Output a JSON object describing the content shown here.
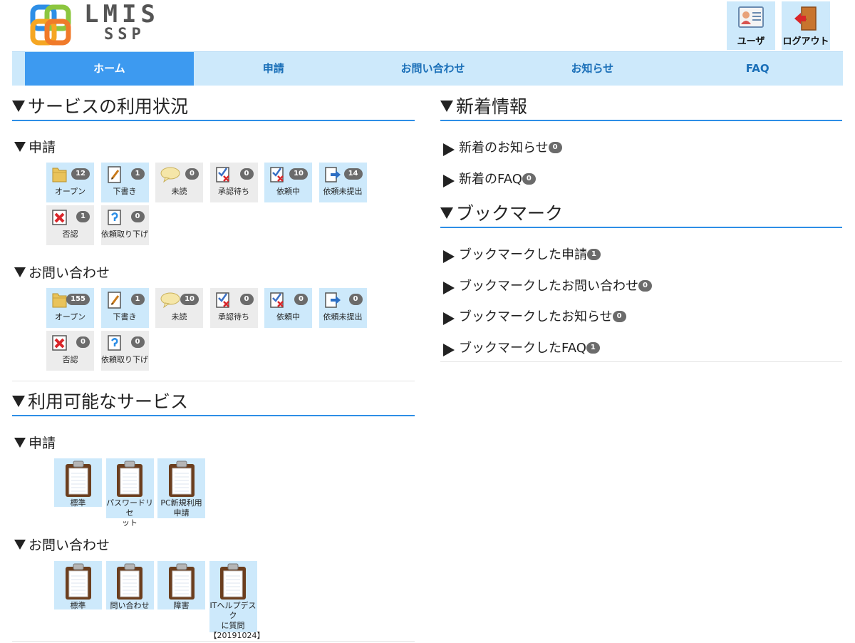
{
  "header": {
    "logo_line1": "LMIS",
    "logo_line2": "SSP",
    "user_label": "ユーザ",
    "logout_label": "ログアウト"
  },
  "nav": {
    "tabs": [
      {
        "label": "ホーム"
      },
      {
        "label": "申請"
      },
      {
        "label": "お問い合わせ"
      },
      {
        "label": "お知らせ"
      },
      {
        "label": "FAQ"
      }
    ]
  },
  "usage": {
    "title": "サービスの利用状況",
    "request": {
      "title": "申請",
      "tiles": [
        {
          "label": "オープン",
          "count": "12"
        },
        {
          "label": "下書き",
          "count": "1"
        },
        {
          "label": "未読",
          "count": "0"
        },
        {
          "label": "承認待ち",
          "count": "0"
        },
        {
          "label": "依頼中",
          "count": "10"
        },
        {
          "label": "依頼未提出",
          "count": "14"
        },
        {
          "label": "否認",
          "count": "1"
        },
        {
          "label": "依頼取り下げ",
          "count": "0"
        }
      ]
    },
    "inquiry": {
      "title": "お問い合わせ",
      "tiles": [
        {
          "label": "オープン",
          "count": "155"
        },
        {
          "label": "下書き",
          "count": "1"
        },
        {
          "label": "未読",
          "count": "10"
        },
        {
          "label": "承認待ち",
          "count": "0"
        },
        {
          "label": "依頼中",
          "count": "0"
        },
        {
          "label": "依頼未提出",
          "count": "0"
        },
        {
          "label": "否認",
          "count": "0"
        },
        {
          "label": "依頼取り下げ",
          "count": "0"
        }
      ]
    }
  },
  "services": {
    "title": "利用可能なサービス",
    "request": {
      "title": "申請",
      "items": [
        {
          "l1": "標準",
          "l2": ""
        },
        {
          "l1": "パスワードリセ",
          "l2": "ット"
        },
        {
          "l1": "PC新規利用",
          "l2": "申請"
        }
      ]
    },
    "inquiry": {
      "title": "お問い合わせ",
      "items": [
        {
          "l1": "標準",
          "l2": "",
          "l3": ""
        },
        {
          "l1": "問い合わせ",
          "l2": "",
          "l3": ""
        },
        {
          "l1": "障害",
          "l2": "",
          "l3": ""
        },
        {
          "l1": "ITヘルプデスク",
          "l2": "に質問",
          "l3": "【20191024】"
        }
      ]
    }
  },
  "news": {
    "title": "新着情報",
    "links": [
      {
        "label": "新着のお知らせ",
        "count": "0"
      },
      {
        "label": "新着のFAQ",
        "count": "0"
      }
    ]
  },
  "bookmarks": {
    "title": "ブックマーク",
    "links": [
      {
        "label": "ブックマークした申請",
        "count": "1"
      },
      {
        "label": "ブックマークしたお問い合わせ",
        "count": "0"
      },
      {
        "label": "ブックマークしたお知らせ",
        "count": "0"
      },
      {
        "label": "ブックマークしたFAQ",
        "count": "1"
      }
    ]
  }
}
